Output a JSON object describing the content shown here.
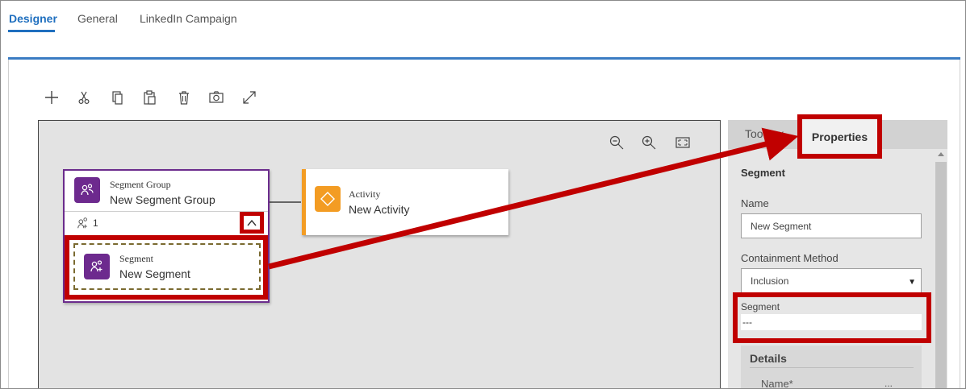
{
  "tabs": [
    {
      "label": "Designer",
      "active": true
    },
    {
      "label": "General",
      "active": false
    },
    {
      "label": "LinkedIn Campaign",
      "active": false
    }
  ],
  "toolbar": {
    "icons": [
      "add-icon",
      "cut-icon",
      "copy-icon",
      "paste-icon",
      "delete-icon",
      "camera-icon",
      "expand-icon"
    ]
  },
  "canvas": {
    "zoom_icons": [
      "zoom-out-icon",
      "zoom-in-icon",
      "fit-to-screen-icon"
    ],
    "segment_group": {
      "kind": "Segment Group",
      "title": "New Segment Group",
      "member_count": "1"
    },
    "segment": {
      "kind": "Segment",
      "title": "New Segment"
    },
    "activity": {
      "kind": "Activity",
      "title": "New Activity"
    }
  },
  "panel": {
    "tab_toolbox": "Toolbox",
    "tab_properties": "Properties",
    "section_title": "Segment",
    "name_label": "Name",
    "name_value": "New Segment",
    "containment_label": "Containment Method",
    "containment_value": "Inclusion",
    "segment_label": "Segment",
    "segment_value": "---",
    "details_title": "Details",
    "details_name_label": "Name*",
    "details_name_value": "..."
  },
  "colors": {
    "accent_blue": "#1f6fbf",
    "segment_purple": "#6d2a8e",
    "activity_orange": "#f39c23",
    "callout_red": "#c00000"
  }
}
